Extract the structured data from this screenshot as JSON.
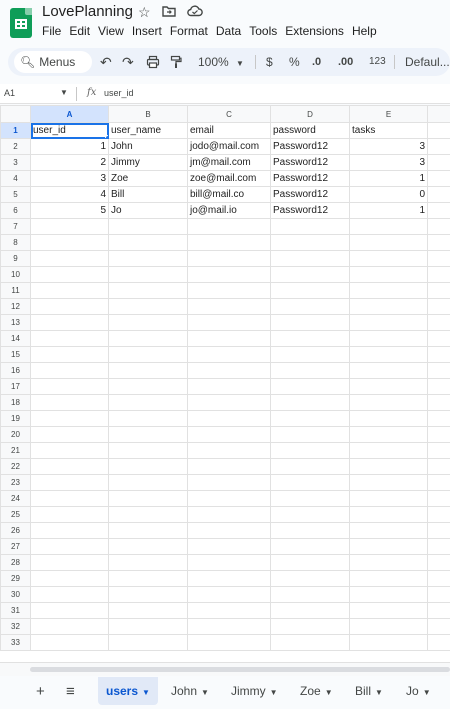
{
  "doc": {
    "title": "LovePlanning"
  },
  "menu": [
    "File",
    "Edit",
    "View",
    "Insert",
    "Format",
    "Data",
    "Tools",
    "Extensions",
    "Help"
  ],
  "toolbar": {
    "search_label": "Menus",
    "zoom": "100%",
    "currency": "$",
    "percent": "%",
    "dec_decrease": ".0",
    "dec_increase": ".00",
    "number_format": "123",
    "font": "Defaul..."
  },
  "formula_bar": {
    "cell_ref": "A1",
    "fx_label": "fx",
    "value": "user_id"
  },
  "grid": {
    "columns": [
      "A",
      "B",
      "C",
      "D",
      "E"
    ],
    "selected_column": "A",
    "selected_row": "1",
    "rows": [
      [
        "user_id",
        "user_name",
        "email",
        "password",
        "tasks"
      ],
      [
        "1",
        "John",
        "jodo@mail.com",
        "Password12",
        "3"
      ],
      [
        "2",
        "Jimmy",
        "jm@mail.com",
        "Password12",
        "3"
      ],
      [
        "3",
        "Zoe",
        "zoe@mail.com",
        "Password12",
        "1"
      ],
      [
        "4",
        "Bill",
        "bill@mail.co",
        "Password12",
        "0"
      ],
      [
        "5",
        "Jo",
        "jo@mail.io",
        "Password12",
        "1"
      ]
    ],
    "row_count": 33
  },
  "sheets": [
    {
      "name": "users",
      "active": true
    },
    {
      "name": "John",
      "active": false
    },
    {
      "name": "Jimmy",
      "active": false
    },
    {
      "name": "Zoe",
      "active": false
    },
    {
      "name": "Bill",
      "active": false
    },
    {
      "name": "Jo",
      "active": false
    }
  ],
  "colors": {
    "accent": "#0b57d0",
    "selection": "#1a73e8",
    "logo": "#0f9d58"
  }
}
